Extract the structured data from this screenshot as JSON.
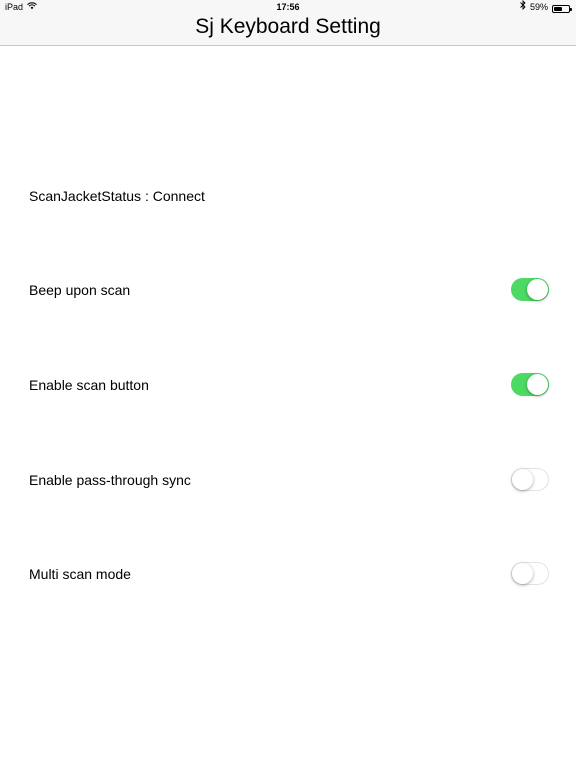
{
  "status_bar": {
    "device": "iPad",
    "wifi_icon": "wifi-icon",
    "time": "17:56",
    "bluetooth_icon": "bluetooth-icon",
    "battery_percent": "59%",
    "battery_level": 0.59
  },
  "nav": {
    "title": "Sj Keyboard Setting"
  },
  "main": {
    "scanjacket_status": "ScanJacketStatus : Connect",
    "settings": [
      {
        "label": "Beep upon scan",
        "on": true
      },
      {
        "label": "Enable scan button",
        "on": true
      },
      {
        "label": "Enable pass-through sync",
        "on": false
      },
      {
        "label": "Multi scan mode",
        "on": false
      }
    ]
  },
  "colors": {
    "switch_on": "#4cd964",
    "switch_off_border": "#e3e3e3",
    "bar_background": "#f7f7f7"
  }
}
